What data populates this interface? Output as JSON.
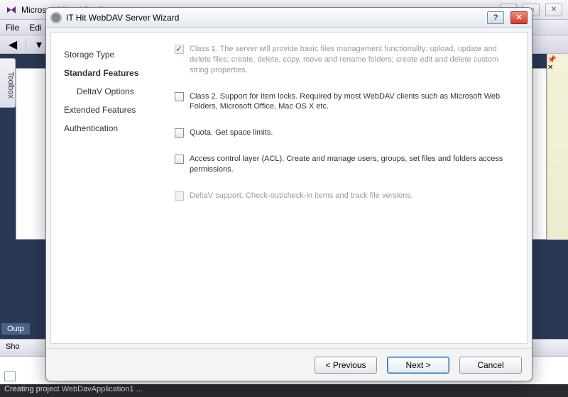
{
  "vs": {
    "title": "Microsoft Visual Studio",
    "menu": {
      "file": "File",
      "edit": "Edi"
    },
    "toolbox_tab": "Toolbox",
    "output_tab": "Outp",
    "show_label": "Sho",
    "status": "Creating project  WebDavApplication1 ..."
  },
  "wizard": {
    "title": "IT Hit WebDAV Server Wizard",
    "nav": {
      "storage": "Storage Type",
      "standard": "Standard Features",
      "deltav": "DeltaV Options",
      "extended": "Extended Features",
      "auth": "Authentication"
    },
    "options": {
      "class1": "Class 1. The server will provide basic files management functionality: upload, update and delete files; create, delete, copy, move and rename folders; create edit and delete custom string properties.",
      "class2": "Class 2. Support for item locks. Required by most WebDAV clients such as Microsoft Web Folders, Microsoft Office, Mac OS X etc.",
      "quota": "Quota. Get space limits.",
      "acl": "Access control layer (ACL). Create and manage users, groups, set files and folders access permissions.",
      "deltav": "DeltaV support. Check-out/check-in items and track file versions."
    },
    "buttons": {
      "prev": "< Previous",
      "next": "Next >",
      "cancel": "Cancel"
    }
  }
}
